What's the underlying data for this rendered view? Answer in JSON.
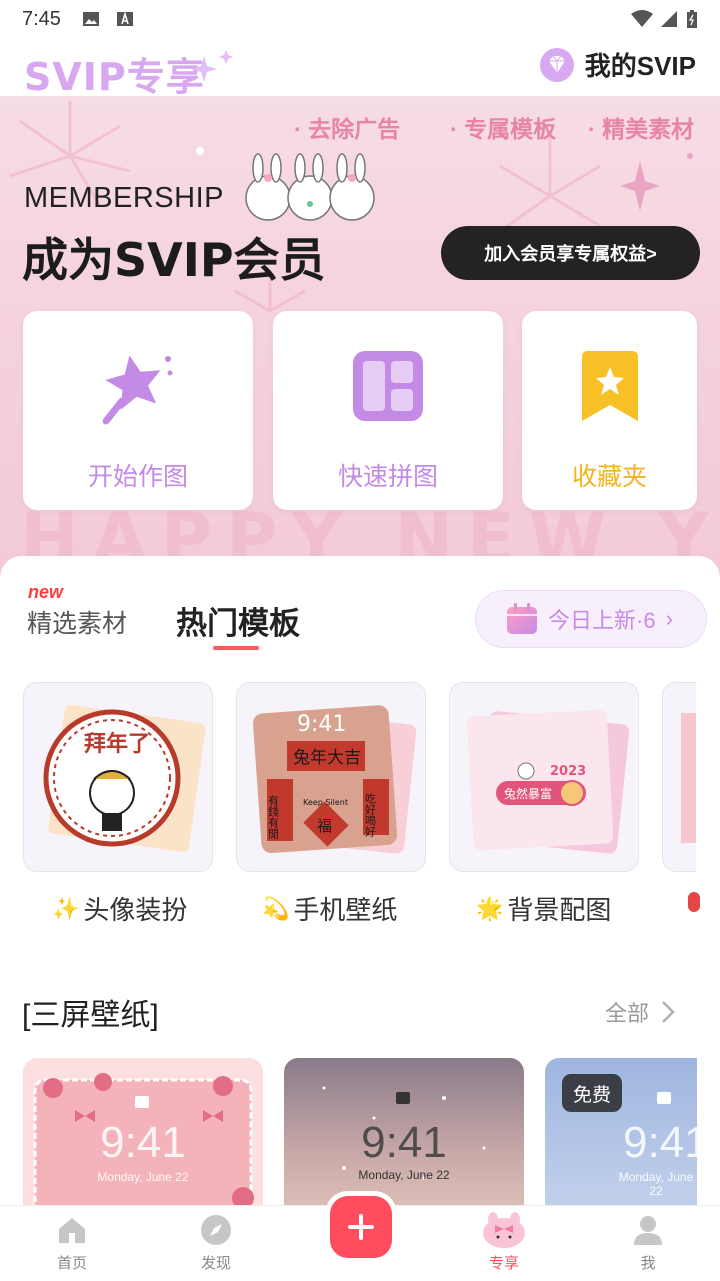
{
  "status_bar": {
    "time": "7:45"
  },
  "header": {
    "title": "SVIP专享",
    "my_svip": "我的SVIP"
  },
  "banner": {
    "benefits": [
      "去除广告",
      "专属模板",
      "精美素材"
    ],
    "membership": "MEMBERSHIP",
    "headline": "成为SVIP会员",
    "join_button": "加入会员享专属权益>",
    "background_text": "HAPPY NEW YEAR"
  },
  "tools": [
    {
      "label": "开始作图",
      "icon": "magic-wand-icon",
      "color": "#c38ae6"
    },
    {
      "label": "快速拼图",
      "icon": "collage-layout-icon",
      "color": "#c38ae6"
    },
    {
      "label": "收藏夹",
      "icon": "bookmark-star-icon",
      "color": "#f2b51f"
    }
  ],
  "tabs": {
    "new_badge": "new",
    "featured": "精选素材",
    "hot": "热门模板"
  },
  "today_new": {
    "label": "今日上新·6",
    "icon": "calendar-icon"
  },
  "templates": [
    {
      "label": "头像装扮",
      "emoji": "✨"
    },
    {
      "label": "手机壁纸",
      "emoji": "💫"
    },
    {
      "label": "背景配图",
      "emoji": "🌟"
    }
  ],
  "template_art": {
    "bainian": "拜年了",
    "lock_time": "9:41",
    "tuniandaji": "兔年大吉",
    "youqian": "有錢有閒",
    "chihao": "吃好喝好",
    "fu": "福",
    "keep_silent": "Keep Silent",
    "year": "2023",
    "tuiran": "兔然暴富"
  },
  "wallpaper_section": {
    "title": "[三屏壁纸]",
    "see_all": "全部"
  },
  "wallpapers": [
    {
      "time": "9:41",
      "date": "Monday, June 22"
    },
    {
      "time": "9:41",
      "date": "Monday, June 22"
    },
    {
      "time": "9:41",
      "date": "Monday, June 22",
      "badge": "免费"
    }
  ],
  "nav": {
    "home": "首页",
    "discover": "发现",
    "exclusive": "专享",
    "me": "我"
  },
  "colors": {
    "accent": "#ff4d5e",
    "svip_purple": "#d7a7f0",
    "active_tab": "#ff4d5e"
  }
}
